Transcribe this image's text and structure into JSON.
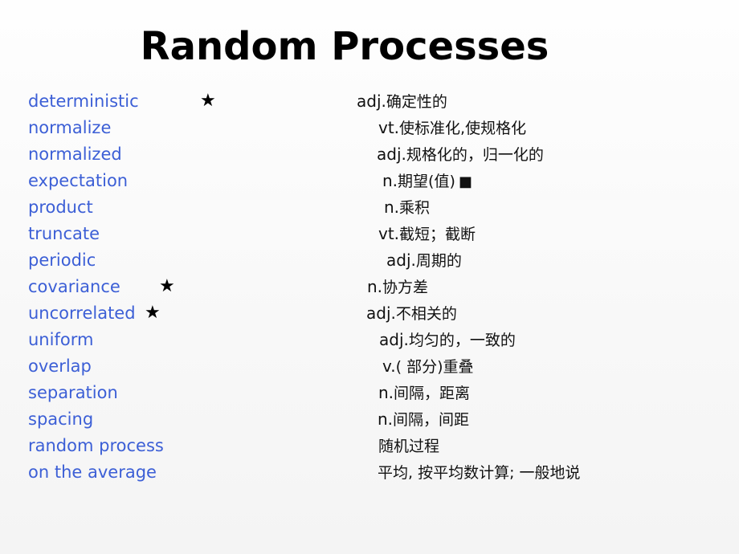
{
  "title": "Random Processes",
  "vocabulary": [
    {
      "term": "deterministic",
      "star": "★",
      "pos": "adj.",
      "meaning": "确定性的"
    },
    {
      "term": "normalize",
      "pos": "vt.",
      "meaning": "使标准化,使规格化"
    },
    {
      "term": "normalized",
      "pos": "adj.",
      "meaning": "规格化的，归一化的"
    },
    {
      "term": "expectation",
      "pos": "n.",
      "meaning": "期望(值)",
      "marker": "■"
    },
    {
      "term": "product",
      "pos": "n.",
      "meaning": "乘积"
    },
    {
      "term": "truncate",
      "pos": "vt.",
      "meaning": "截短；截断"
    },
    {
      "term": "periodic",
      "pos": "adj.",
      "meaning": "周期的"
    },
    {
      "term": "covariance",
      "star": "★",
      "pos": "n.",
      "meaning": "协方差"
    },
    {
      "term": "uncorrelated",
      "star": "★",
      "pos": "adj.",
      "meaning": "不相关的"
    },
    {
      "term": "uniform",
      "pos": "adj.",
      "meaning": "均匀的，一致的"
    },
    {
      "term": "overlap",
      "pos": "v.",
      "meaning": "( 部分)重叠"
    },
    {
      "term": "separation",
      "pos": "n.",
      "meaning": "间隔，距离"
    },
    {
      "term": "spacing",
      "pos": "n.",
      "meaning": "间隔，间距"
    },
    {
      "term": "random process",
      "pos": "",
      "meaning": "随机过程"
    },
    {
      "term": "on the average",
      "pos": "",
      "meaning": "平均, 按平均数计算; 一般地说"
    }
  ]
}
